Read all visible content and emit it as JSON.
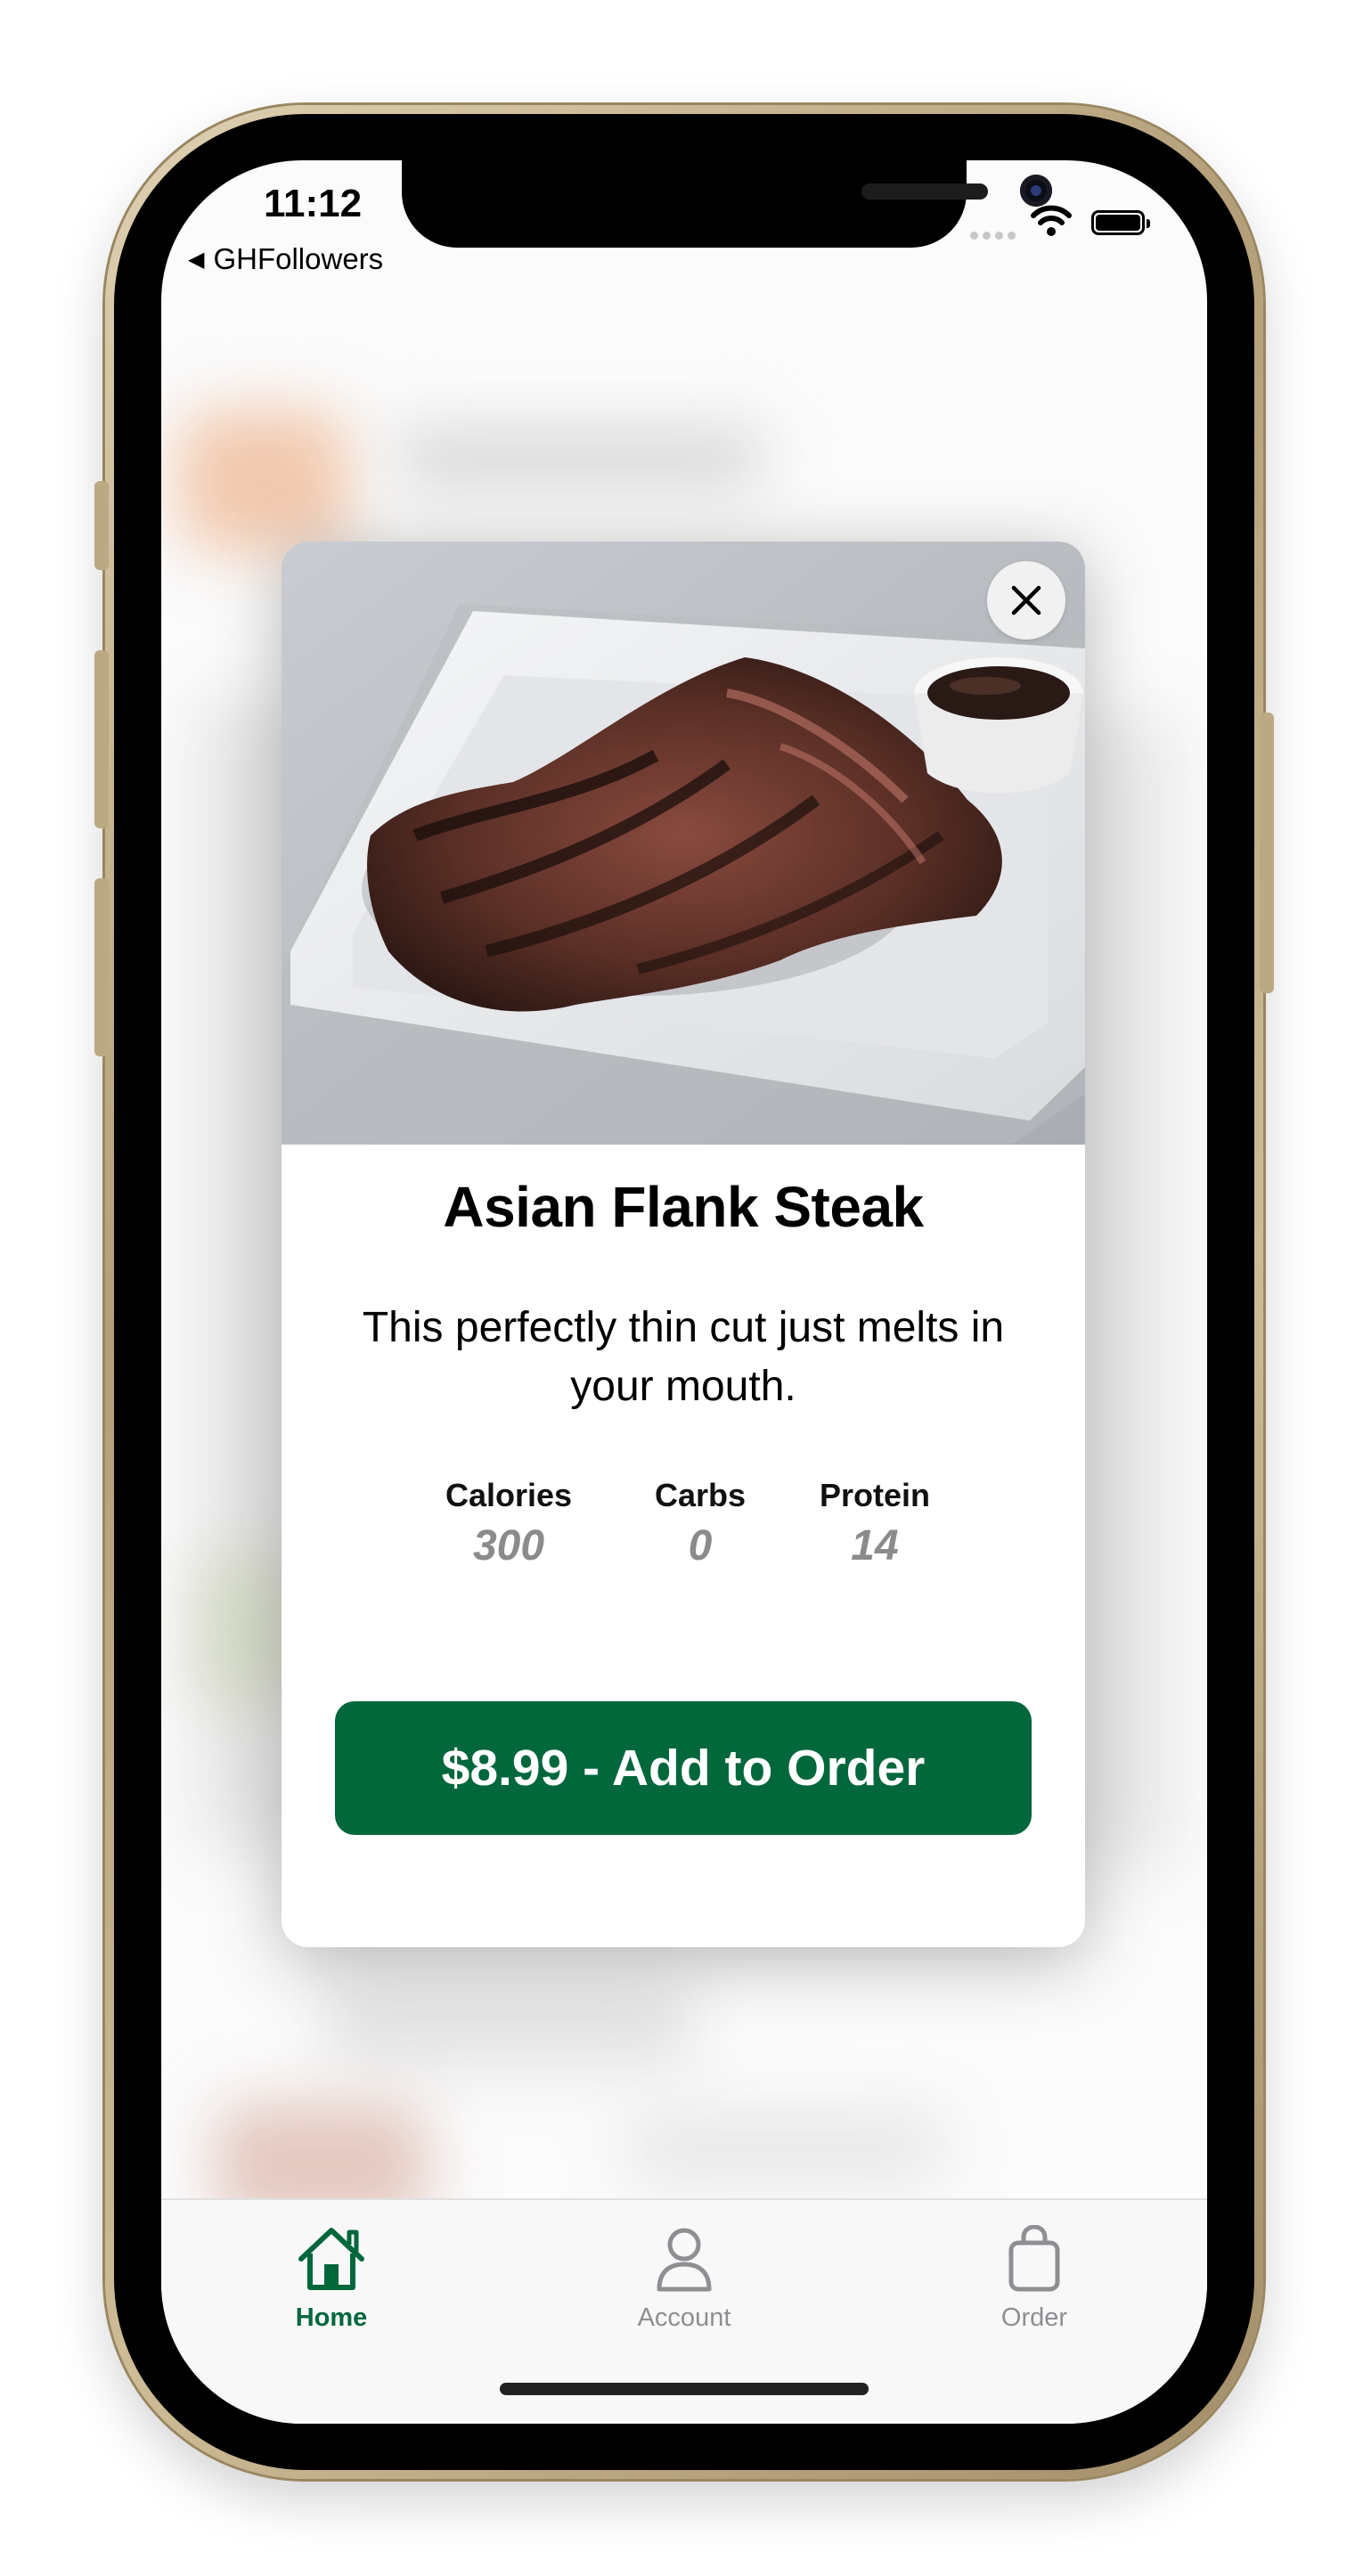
{
  "status_bar": {
    "time": "11:12",
    "back_app": "GHFollowers",
    "icons": [
      "cellular-icon",
      "wifi-icon",
      "battery-icon"
    ]
  },
  "modal": {
    "image_icon": "flank-steak-photo",
    "close_icon": "close-icon",
    "title": "Asian Flank Steak",
    "description": "This perfectly thin cut just melts in your mouth.",
    "nutrition": [
      {
        "label": "Calories",
        "value": "300"
      },
      {
        "label": "Carbs",
        "value": "0"
      },
      {
        "label": "Protein",
        "value": "14"
      }
    ],
    "add_button_label": "$8.99 - Add to Order"
  },
  "tab_bar": {
    "items": [
      {
        "label": "Home",
        "icon": "house-icon",
        "selected": true
      },
      {
        "label": "Account",
        "icon": "person-icon",
        "selected": false
      },
      {
        "label": "Order",
        "icon": "bag-icon",
        "selected": false
      }
    ]
  },
  "colors": {
    "accent": "#03673c",
    "tab_inactive": "#8e8e93",
    "nutrition_value": "#8b8b8b",
    "frame_gold": "#cdbc96"
  }
}
